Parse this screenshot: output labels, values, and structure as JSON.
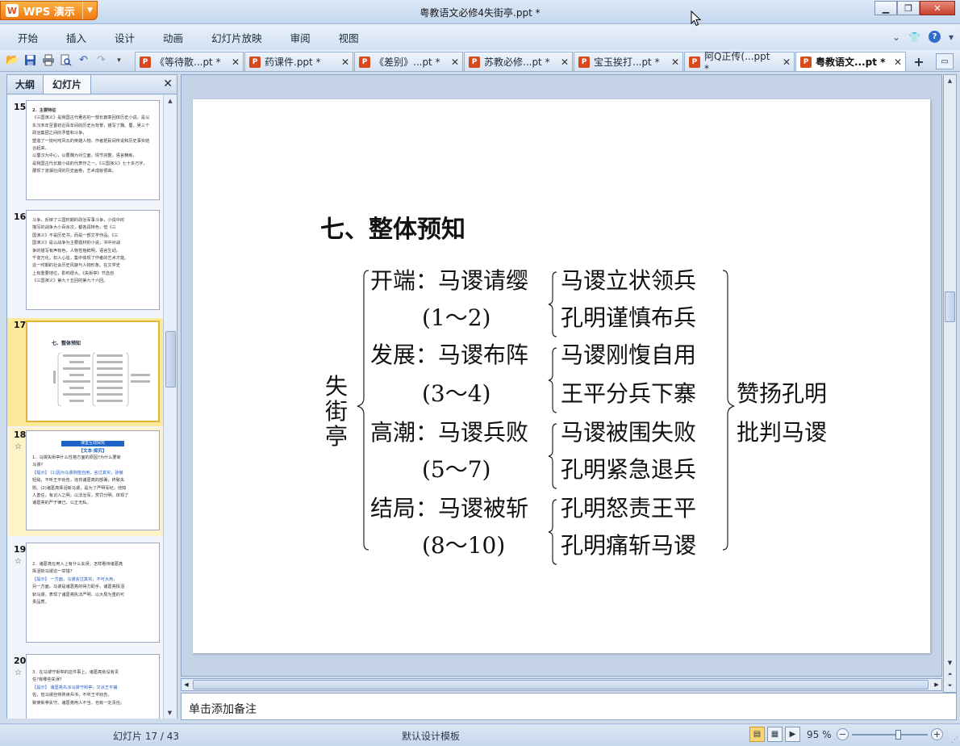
{
  "app": {
    "brand": "WPS 演示",
    "brand_logo": "W",
    "window_title": "粤教语文必修4失街亭.ppt *"
  },
  "menu": [
    "开始",
    "插入",
    "设计",
    "动画",
    "幻灯片放映",
    "审阅",
    "视图"
  ],
  "quick_toolbar": [
    "open-folder-icon",
    "save-icon",
    "print-icon",
    "print-preview-icon",
    "undo-icon",
    "redo-icon",
    "customize-icon"
  ],
  "tabs": [
    {
      "label": "《等待散...pt *",
      "active": false
    },
    {
      "label": "药课件.ppt *",
      "active": false
    },
    {
      "label": "《差别》...pt *",
      "active": false
    },
    {
      "label": "苏教必修...pt *",
      "active": false
    },
    {
      "label": "宝玉挨打...pt *",
      "active": false
    },
    {
      "label": "阿Q正传(...ppt *",
      "active": false
    },
    {
      "label": "粤教语文...pt *",
      "active": true
    }
  ],
  "side_panel": {
    "tab_outline": "大纲",
    "tab_slides": "幻灯片",
    "thumbnails": [
      {
        "num": "15",
        "star": false,
        "lines": [
          "2．主要特征",
          "《三国演义》是我国古代著名的一部长篇章回体历史小说，是以东汉末年至晋初近百年间的历史为背景，描写了魏、蜀、吴三个政治集团之间的矛盾和斗争，",
          "塑造了一批叱咤风云的英雄人物。作者把民间传说和历史事实结合起来，",
          "以蜀汉为中心，以曹魏为对立面，情节完整，语言精练，",
          "是我国古代长篇小说的代表作之一。《三国演义》七十多万字，",
          "展现了波澜壮阔的历史画卷，艺术成就很高。"
        ]
      },
      {
        "num": "16",
        "star": false,
        "lines": [
          "斗争，反映了三国时期的政治军事斗争，小说中的",
          "描写的战争大小百余次，都各具特色，但《三",
          "国演义》不是历史书，而是一部文学作品。《三",
          "国演义》是以战争为主要题材的小说，书中对战",
          "争的描写有声有色，人物性格鲜明，语言生动，",
          "千变万化，扣人心弦，集中体现了作者的艺术才能。",
          "这一时期的社会历史风貌与人物形象。在文学史",
          "上有重要地位，影响很大。《失街亭》节选自",
          "《三国演义》第九十五回的第九十六回。"
        ]
      },
      {
        "num": "17",
        "star": false,
        "title": "七、整体预知",
        "mini": true
      },
      {
        "num": "18",
        "star": true,
        "head": "课堂互动探究",
        "sub": "【文本·探究】",
        "lines": [
          "1．马谡失街亭什么性格方面的原因?为什么要斩",
          "马谡?",
          "【提示】 (1)因为马谡刚愎自用，言过其实，骄傲",
          "轻敌，不听王平劝告，违背诸葛亮的部署，终致失",
          "败。(2)诸葛亮挥泪斩马谡，是为了严明军纪，他知",
          "人善任，有识人之明，以法治军，赏罚分明，体现了",
          "诸葛亮的严于律己，公正无私。"
        ]
      },
      {
        "num": "19",
        "star": true,
        "lines": [
          "2．诸葛亮在用人上有什么失误，怎样看待诸葛亮",
          "挥泪斩马谡这一举措?",
          "【提示】 一方面，马谡言过其实，不可大用，",
          "另一方面，马谡是诸葛亮的得力助手。诸葛亮挥泪",
          "斩马谡，表现了诸葛亮执法严明、以大局为重的可",
          "贵品质。"
        ]
      },
      {
        "num": "20",
        "star": true,
        "lines": [
          "3．在马谡守街亭的这件事上，诸葛亮有没有责",
          "任?有哪些失误?",
          "【提示】 诸葛亮先派马谡守街亭，又派王平辅",
          "佐，但马谡自恃熟读兵书，不听王平劝告，",
          "致使街亭失守。诸葛亮用人不当，也有一定责任。"
        ]
      }
    ]
  },
  "slide": {
    "title": "七、整体预知",
    "root": [
      "失",
      "街",
      "亭"
    ],
    "stages": [
      {
        "label": "开端：马谡请缨",
        "range": "(1～2)",
        "events": [
          "马谡立状领兵",
          "孔明谨慎布兵"
        ]
      },
      {
        "label": "发展：马谡布阵",
        "range": "(3～4)",
        "events": [
          "马谡刚愎自用",
          "王平分兵下寨"
        ]
      },
      {
        "label": "高潮：马谡兵败",
        "range": "(5～7)",
        "events": [
          "马谡被围失败",
          "孔明紧急退兵"
        ]
      },
      {
        "label": "结局：马谡被斩",
        "range": "(8～10)",
        "events": [
          "孔明怒责王平",
          "孔明痛斩马谡"
        ]
      }
    ],
    "conclusions": [
      "赞扬孔明",
      "批判马谡"
    ]
  },
  "notes_placeholder": "单击添加备注",
  "status": {
    "slide_counter": "幻灯片 17 / 43",
    "template": "默认设计模板",
    "zoom": "95 %",
    "zoom_level_percent": 95
  }
}
